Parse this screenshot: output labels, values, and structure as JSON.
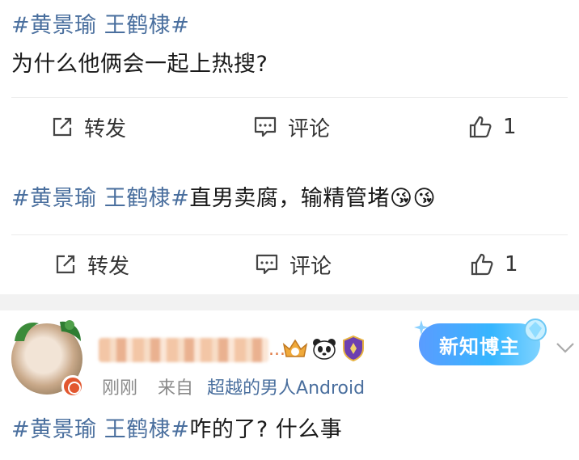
{
  "post1": {
    "hashtag": "#黄景瑜 王鹤棣#",
    "text": "为什么他俩会一起上热搜?",
    "actions": {
      "repost": "转发",
      "comment": "评论",
      "like_count": "1"
    }
  },
  "post2": {
    "hashtag": "#黄景瑜 王鹤棣#",
    "text": "直男卖腐，输精管堵",
    "emoji": "😘😘",
    "actions": {
      "repost": "转发",
      "comment": "评论",
      "like_count": "1"
    }
  },
  "post3": {
    "username_suffix": "...",
    "meta": {
      "time": "刚刚",
      "from": "来自",
      "source": "超越的男人Android"
    },
    "badge_label": "新知博主",
    "hashtag": "#黄景瑜 王鹤棣#",
    "text": "咋的了? 什么事"
  },
  "colors": {
    "link": "#4a6f9e",
    "text": "#1a1a1a",
    "muted": "#8a8a8a",
    "divider": "#ececec",
    "band": "#f2f2f2",
    "pill": "#36b6ff"
  },
  "icons": [
    "share-icon",
    "comment-icon",
    "thumbs-up-icon",
    "vip-badge-icon",
    "crown-badge-icon",
    "panda-icon",
    "shield-icon",
    "chevron-down-icon",
    "gem-icon"
  ]
}
